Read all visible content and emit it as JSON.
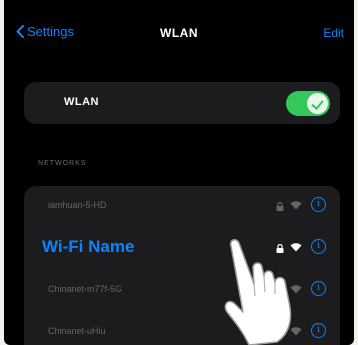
{
  "nav": {
    "back_label": "Settings",
    "title": "WLAN",
    "edit_label": "Edit"
  },
  "wlan": {
    "label": "WLAN",
    "enabled": true
  },
  "section_header": "NETWORKS",
  "networks": [
    {
      "name": "iamhuan-5-HD",
      "active": false
    },
    {
      "name": "Wi-Fi Name",
      "active": true
    },
    {
      "name": "Chinanet-m77f-5G",
      "active": false
    },
    {
      "name": "Chinanet-uHiu",
      "active": false
    }
  ],
  "colors": {
    "accent": "#0a84ff",
    "toggle_on": "#34c759",
    "card_bg": "#1c1c1e"
  }
}
